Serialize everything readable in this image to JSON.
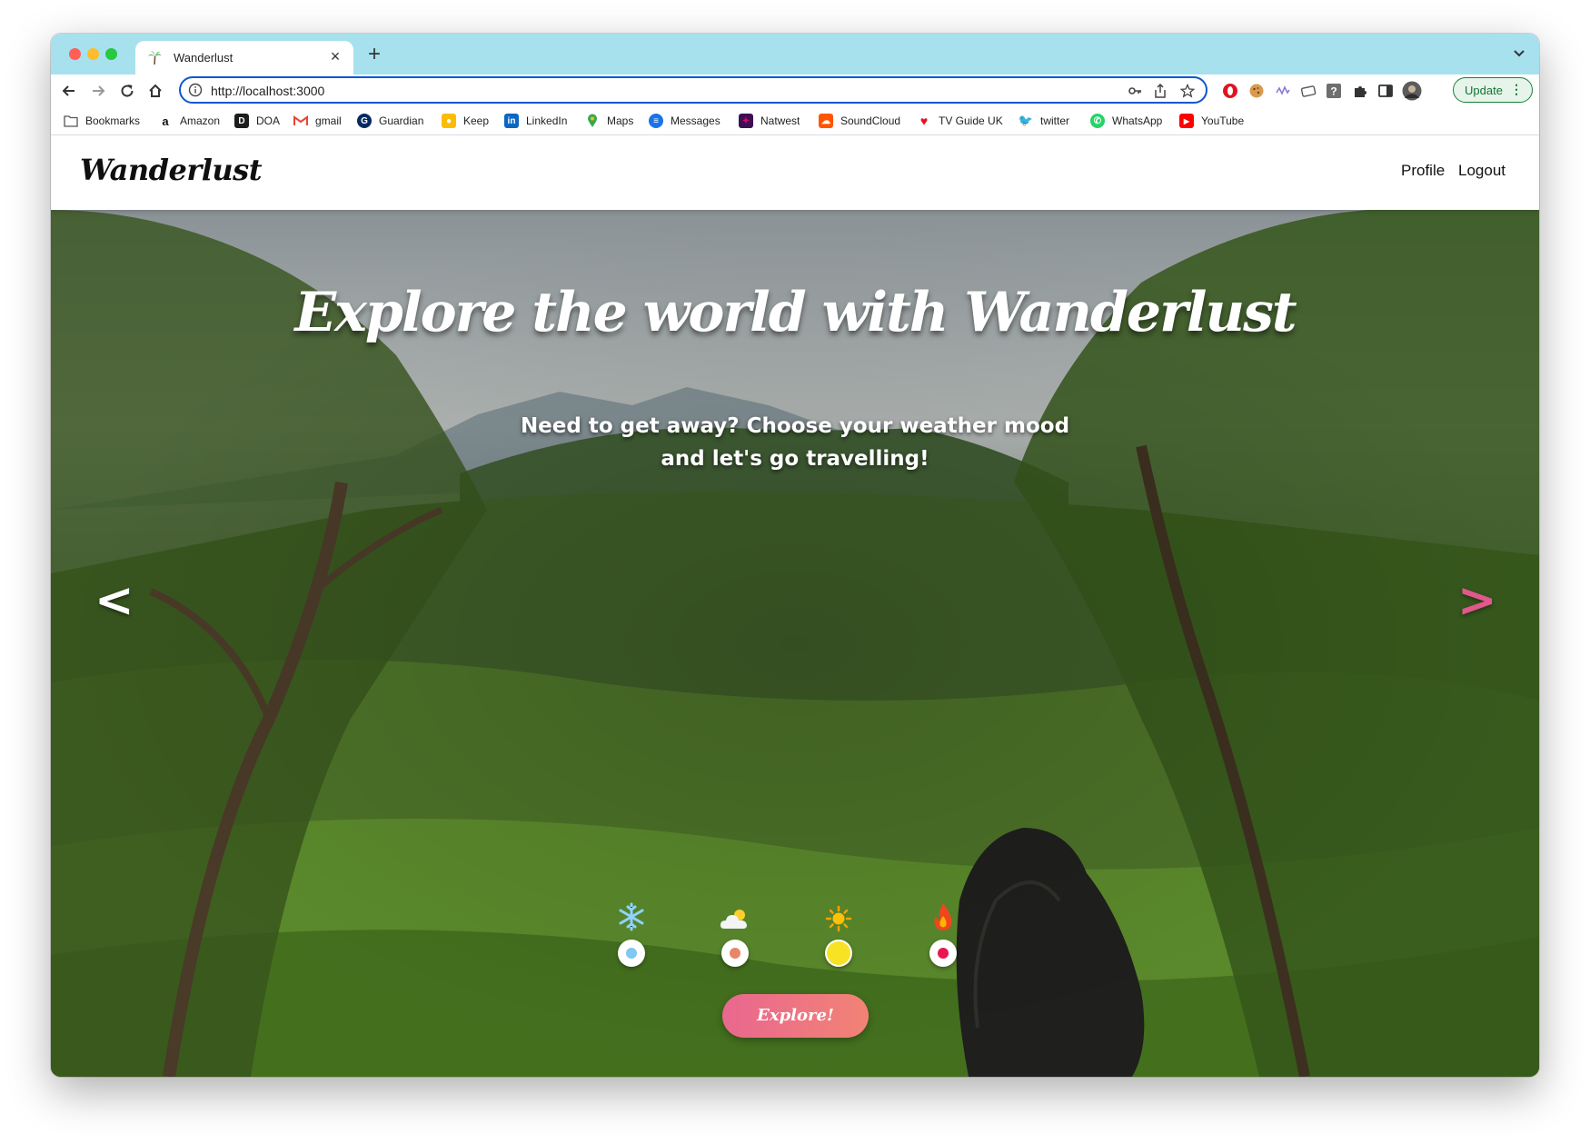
{
  "browser": {
    "tab_title": "Wanderlust",
    "url": "http://localhost:3000",
    "update_label": "Update",
    "accent_color": "#a7e1ee"
  },
  "bookmarks": [
    {
      "label": "Bookmarks",
      "icon": "folder-icon"
    },
    {
      "label": "Amazon",
      "icon": "amazon-icon"
    },
    {
      "label": "DOA",
      "icon": "doa-icon"
    },
    {
      "label": "gmail",
      "icon": "gmail-icon"
    },
    {
      "label": "Guardian",
      "icon": "guardian-icon"
    },
    {
      "label": "Keep",
      "icon": "keep-icon"
    },
    {
      "label": "LinkedIn",
      "icon": "linkedin-icon"
    },
    {
      "label": "Maps",
      "icon": "maps-icon"
    },
    {
      "label": "Messages",
      "icon": "messages-icon"
    },
    {
      "label": "Natwest",
      "icon": "natwest-icon"
    },
    {
      "label": "SoundCloud",
      "icon": "soundcloud-icon"
    },
    {
      "label": "TV Guide UK",
      "icon": "tvguide-icon"
    },
    {
      "label": "twitter",
      "icon": "twitter-icon"
    },
    {
      "label": "WhatsApp",
      "icon": "whatsapp-icon"
    },
    {
      "label": "YouTube",
      "icon": "youtube-icon"
    }
  ],
  "site": {
    "logo": "Wanderlust",
    "nav": {
      "profile": "Profile",
      "logout": "Logout"
    }
  },
  "hero": {
    "headline": "Explore the world with Wanderlust",
    "subheadline": "Need to get away? Choose your weather mood and let's go travelling!",
    "prev_arrow": "<",
    "next_arrow": ">",
    "moods": [
      {
        "name": "cold",
        "icon": "snowflake-icon",
        "emoji": "❄️",
        "dot_color": "#7ec8f3"
      },
      {
        "name": "mild",
        "icon": "cloud-icon",
        "emoji": "☁️",
        "dot_color": "#e8866a"
      },
      {
        "name": "sunny",
        "icon": "sun-icon",
        "emoji": "☀️",
        "dot_color": "#f7e224",
        "selected": true
      },
      {
        "name": "hot",
        "icon": "fire-icon",
        "emoji": "🔥",
        "dot_color": "#e8174f"
      }
    ],
    "explore_label": "Explore!"
  }
}
